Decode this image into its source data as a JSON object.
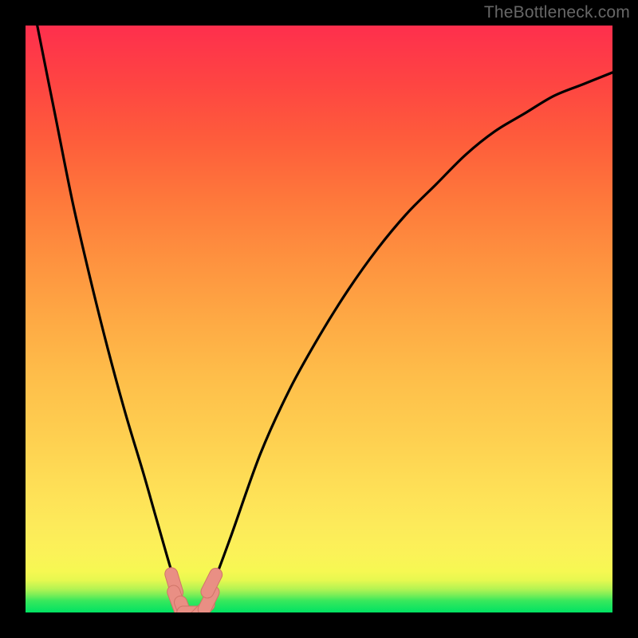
{
  "watermark": "TheBottleneck.com",
  "colors": {
    "curve_stroke": "#000000",
    "marker_fill": "#E98F84",
    "marker_stroke": "#D07468",
    "gradient_top": "#FE2F4D",
    "gradient_bottom": "#00E263",
    "page_bg": "#000000"
  },
  "chart_data": {
    "type": "line",
    "title": "",
    "xlabel": "",
    "ylabel": "",
    "xlim": [
      0,
      100
    ],
    "ylim": [
      0,
      100
    ],
    "note": "Bottleneck-percentage style curve: a V-shaped function where the minimum (~0) is the optimal component balance and values rise toward 100 on either side. Values below are estimated from the rendered pixels; the chart has no numeric tick labels.",
    "x": [
      0,
      2,
      5,
      8,
      11,
      14,
      17,
      20,
      22,
      24,
      25.5,
      27,
      28,
      29,
      30,
      32,
      35,
      40,
      45,
      50,
      55,
      60,
      65,
      70,
      75,
      80,
      85,
      90,
      95,
      100
    ],
    "values": [
      111,
      100,
      85,
      70,
      57,
      45,
      34,
      24,
      17,
      10,
      5,
      1,
      0,
      0,
      1,
      5,
      13,
      27,
      38,
      47,
      55,
      62,
      68,
      73,
      78,
      82,
      85,
      88,
      90,
      92
    ],
    "markers": [
      {
        "x": 25.3,
        "y": 5.0
      },
      {
        "x": 25.8,
        "y": 2.0
      },
      {
        "x": 27.0,
        "y": 0.2
      },
      {
        "x": 28.5,
        "y": 0.0
      },
      {
        "x": 30.0,
        "y": 0.2
      },
      {
        "x": 31.2,
        "y": 2.0
      },
      {
        "x": 31.7,
        "y": 5.0
      }
    ]
  }
}
